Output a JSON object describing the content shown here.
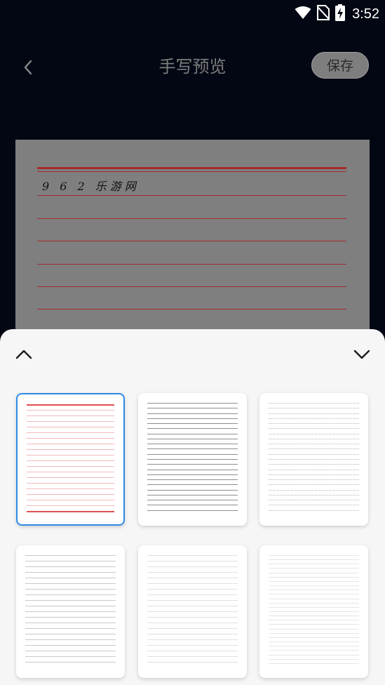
{
  "status_bar": {
    "time": "3:52"
  },
  "header": {
    "title": "手写预览",
    "save_label": "保存"
  },
  "preview": {
    "text": "9 6 2 乐游网"
  },
  "templates": [
    {
      "style": "red-lined",
      "selected": true
    },
    {
      "style": "gray-lined",
      "selected": false
    },
    {
      "style": "dotted",
      "selected": false
    },
    {
      "style": "light-lined",
      "selected": false
    },
    {
      "style": "faint-lined",
      "selected": false
    },
    {
      "style": "faint-lined-dense",
      "selected": false
    }
  ],
  "colors": {
    "background": "#020713",
    "sheet": "#f6f6f6",
    "accent": "#2e8ae6",
    "red_line": "#a42c2c"
  }
}
